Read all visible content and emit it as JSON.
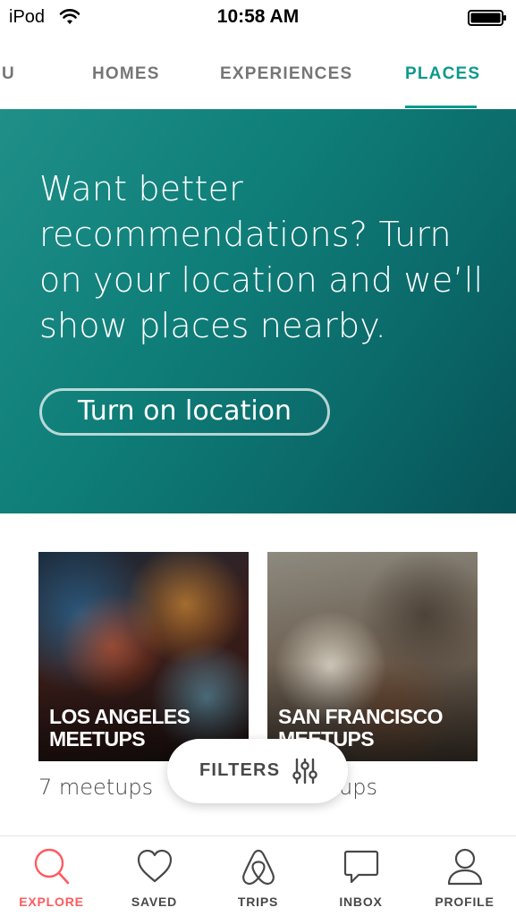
{
  "status_bar": {
    "carrier": "iPod",
    "time": "10:58 AM",
    "icons": [
      "wifi-icon",
      "battery-icon"
    ]
  },
  "tabs": [
    {
      "label": "YOU",
      "visible_text": "OU",
      "active": false
    },
    {
      "label": "HOMES",
      "active": false
    },
    {
      "label": "EXPERIENCES",
      "active": false
    },
    {
      "label": "PLACES",
      "active": true
    }
  ],
  "banner": {
    "message": "Want better recommendations? Turn on your location and we’ll show places nearby.",
    "button_label": "Turn on location"
  },
  "cards": [
    {
      "title": "LOS ANGELES MEETUPS",
      "count": "7 meetups"
    },
    {
      "title": "SAN FRANCISCO MEETUPS",
      "count": "ups"
    }
  ],
  "filters": {
    "label": "FILTERS",
    "icon": "sliders-icon"
  },
  "bottom_nav": [
    {
      "label": "EXPLORE",
      "icon": "search-icon",
      "active": true
    },
    {
      "label": "SAVED",
      "icon": "heart-icon",
      "active": false
    },
    {
      "label": "TRIPS",
      "icon": "airbnb-logo-icon",
      "active": false
    },
    {
      "label": "INBOX",
      "icon": "chat-icon",
      "active": false
    },
    {
      "label": "PROFILE",
      "icon": "person-icon",
      "active": false
    }
  ],
  "colors": {
    "accent_teal": "#0a9a8c",
    "active_red": "#ff5a5f",
    "text_gray": "#484848"
  }
}
